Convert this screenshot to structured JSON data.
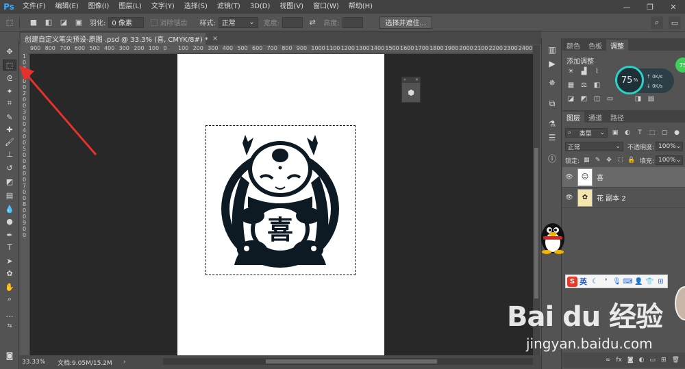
{
  "app": {
    "logo": "Ps",
    "menu": [
      "文件(F)",
      "编辑(E)",
      "图像(I)",
      "图层(L)",
      "文字(Y)",
      "选择(S)",
      "滤镜(T)",
      "3D(D)",
      "视图(V)",
      "窗口(W)",
      "帮助(H)"
    ],
    "window_controls": [
      "—",
      "❐",
      "✕"
    ]
  },
  "options": {
    "feather_label": "羽化:",
    "feather_value": "0 像素",
    "antialias_label": "消除锯齿",
    "style_label": "样式:",
    "style_value": "正常",
    "width_label": "宽度:",
    "height_label": "高度:",
    "select_mask_button": "选择并遮住..."
  },
  "document": {
    "tab_title": "创建自定义笔尖预设-原图 .psd @ 33.3% (喜, CMYK/8#) *",
    "tab_close": "×",
    "ruler_h": [
      "900",
      "800",
      "700",
      "600",
      "500",
      "400",
      "300",
      "200",
      "100",
      "0",
      "100",
      "200",
      "300",
      "400",
      "500",
      "600",
      "700",
      "800",
      "900",
      "1000",
      "1100",
      "1200",
      "1300",
      "1400",
      "1500",
      "1600",
      "1700",
      "1800",
      "1900",
      "2000",
      "2100",
      "2200",
      "2300",
      "2400",
      "2500"
    ],
    "ruler_v": [
      "1",
      "0",
      "0",
      "1",
      "0",
      "0",
      "2",
      "0",
      "0",
      "3",
      "0",
      "0",
      "4",
      "0",
      "0",
      "5",
      "0",
      "0",
      "6",
      "0",
      "0",
      "7",
      "0",
      "0",
      "8",
      "0",
      "0",
      "9",
      "0",
      "0"
    ],
    "artwork_char": "喜"
  },
  "status": {
    "zoom": "33.33%",
    "doc_info": "文档:9.05M/15.2M",
    "arrow": "›"
  },
  "panels": {
    "top_tabs": [
      "颜色",
      "色板",
      "调整"
    ],
    "adjust_title": "添加调整",
    "layers_tabs": [
      "图层",
      "通道",
      "路径"
    ],
    "filter_kind": "类型",
    "blend_mode": "正常",
    "opacity_label": "不透明度:",
    "opacity_value": "100%",
    "lock_label": "锁定:",
    "fill_label": "填充:",
    "fill_value": "100%",
    "layers": [
      {
        "name": "喜",
        "selected": true
      },
      {
        "name": "花 副本 2",
        "selected": false
      }
    ],
    "bottom_icons": [
      "∞",
      "fx",
      "◙",
      "◐",
      "▭",
      "⊞",
      "🗑"
    ]
  },
  "speed_widget": {
    "percent": "75",
    "percent_sign": "%",
    "up": "0K/s",
    "down": "0K/s",
    "badge": "75"
  },
  "ime": {
    "lang": "英"
  },
  "watermark": {
    "brand": "Bai du 经验",
    "url": "jingyan.baidu.com"
  },
  "colors": {
    "foreground": "#e010c8",
    "background": "#ffffff",
    "arrow": "#e8312a"
  }
}
